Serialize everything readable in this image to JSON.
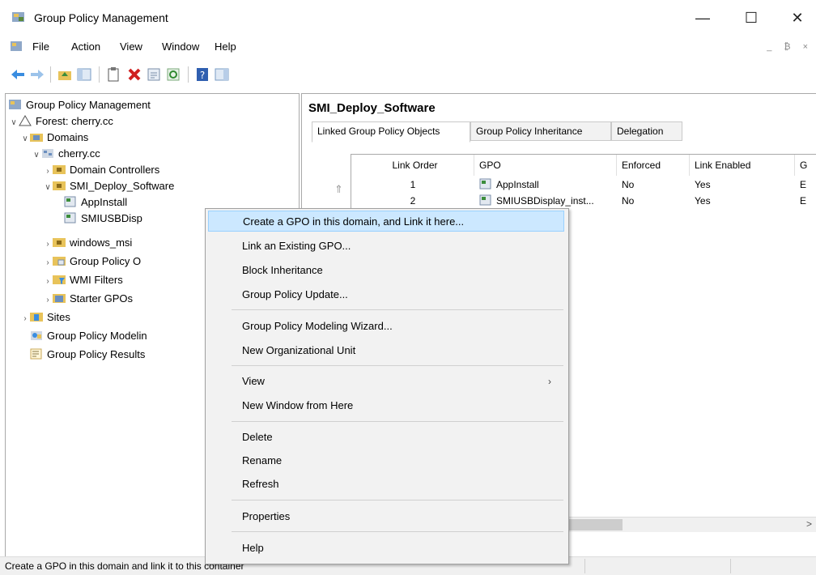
{
  "window": {
    "title": "Group Policy Management",
    "minimize": "—",
    "maximize": "☐",
    "close": "✕"
  },
  "menubar": {
    "items": [
      "File",
      "Action",
      "View",
      "Window",
      "Help"
    ],
    "mdi": "_ ₿ ×"
  },
  "tree": {
    "items": [
      {
        "label": "Group Policy Management",
        "chev": "",
        "indent": 0
      },
      {
        "label": "Forest: cherry.cc",
        "chev": "∨",
        "indent": 1
      },
      {
        "label": "Domains",
        "chev": "∨",
        "indent": 2
      },
      {
        "label": "cherry.cc",
        "chev": "∨",
        "indent": 3
      },
      {
        "label": "Domain Controllers",
        "chev": "›",
        "indent": 4
      },
      {
        "label": "SMI_Deploy_Software",
        "chev": "∨",
        "indent": 4
      },
      {
        "label": "AppInstall",
        "chev": "",
        "indent": 5
      },
      {
        "label": "SMIUSBDisp",
        "chev": "",
        "indent": 5
      },
      {
        "label": "windows_msi",
        "chev": "›",
        "indent": 4
      },
      {
        "label": "Group Policy O",
        "chev": "›",
        "indent": 4
      },
      {
        "label": "WMI Filters",
        "chev": "›",
        "indent": 4
      },
      {
        "label": "Starter GPOs",
        "chev": "›",
        "indent": 4
      },
      {
        "label": "Sites",
        "chev": "›",
        "indent": 2
      },
      {
        "label": "Group Policy Modelin",
        "chev": "",
        "indent": 2
      },
      {
        "label": "Group Policy Results",
        "chev": "",
        "indent": 2
      }
    ]
  },
  "right": {
    "heading": "SMI_Deploy_Software",
    "tabs": [
      "Linked Group Policy Objects",
      "Group Policy Inheritance",
      "Delegation"
    ],
    "columns": [
      "Link Order",
      "GPO",
      "Enforced",
      "Link Enabled",
      "G"
    ],
    "rows": [
      {
        "order": "1",
        "gpo": "AppInstall",
        "enforced": "No",
        "enabled": "Yes",
        "g": "E"
      },
      {
        "order": "2",
        "gpo": "SMIUSBDisplay_inst...",
        "enforced": "No",
        "enabled": "Yes",
        "g": "E"
      }
    ]
  },
  "context_menu": {
    "items": [
      "Create a GPO in this domain, and Link it here...",
      "Link an Existing GPO...",
      "Block Inheritance",
      "Group Policy Update...",
      "Group Policy Modeling Wizard...",
      "New Organizational Unit",
      "View",
      "New Window from Here",
      "Delete",
      "Rename",
      "Refresh",
      "Properties",
      "Help"
    ],
    "submenu_arrow": "›"
  },
  "status": {
    "text": "Create a GPO in this domain and link it to this container"
  },
  "colors": {
    "highlight": "#cce8ff",
    "folder": "#e8c35a",
    "arrow": "#3a8de0"
  }
}
